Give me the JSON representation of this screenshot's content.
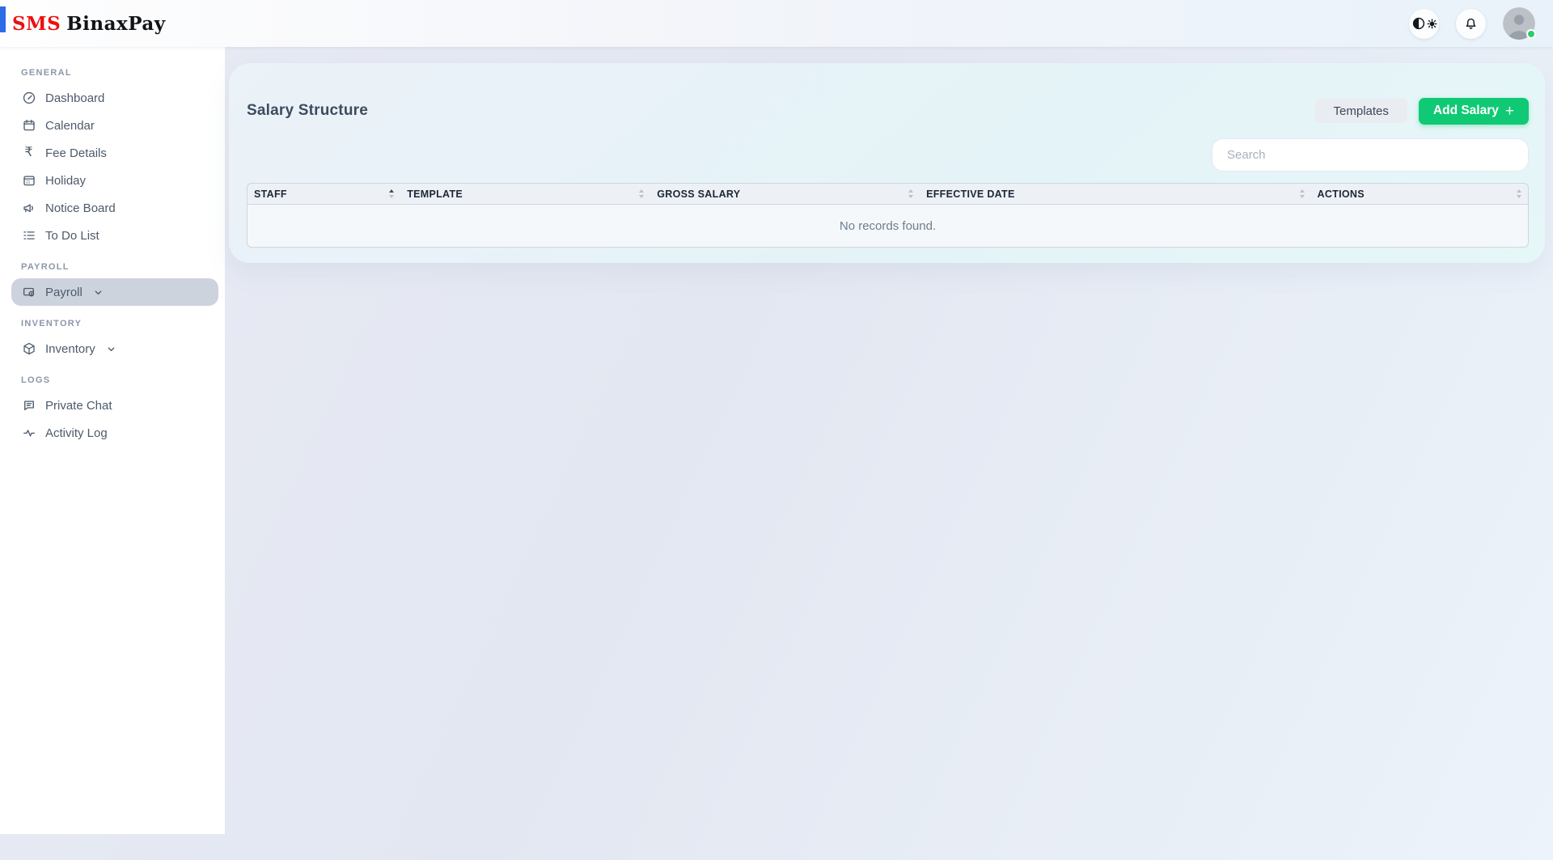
{
  "topbar": {
    "logo_sms": "SMS",
    "logo_brand": "BinaxPay",
    "icons": {
      "theme_toggle": "contrast-sun-icon",
      "notifications": "bell-icon",
      "avatar": "user-avatar",
      "status": "online-green-dot"
    }
  },
  "sidebar": {
    "sections": [
      {
        "label": "GENERAL",
        "items": [
          {
            "label": "Dashboard",
            "icon": "dashboard-gauge-icon"
          },
          {
            "label": "Calendar",
            "icon": "calendar-icon"
          },
          {
            "label": "Fee Details",
            "icon": "rupee-icon"
          },
          {
            "label": "Holiday",
            "icon": "holiday-calendar-icon"
          },
          {
            "label": "Notice Board",
            "icon": "megaphone-icon"
          },
          {
            "label": "To Do List",
            "icon": "todo-list-icon"
          }
        ]
      },
      {
        "label": "PAYROLL",
        "items": [
          {
            "label": "Payroll",
            "icon": "payroll-cheque-icon",
            "expandable": true,
            "active": true
          }
        ]
      },
      {
        "label": "INVENTORY",
        "items": [
          {
            "label": "Inventory",
            "icon": "package-box-icon",
            "expandable": true
          }
        ]
      },
      {
        "label": "LOGS",
        "items": [
          {
            "label": "Private Chat",
            "icon": "chat-bubble-icon"
          },
          {
            "label": "Activity Log",
            "icon": "activity-pulse-icon"
          }
        ]
      }
    ]
  },
  "main": {
    "title": "Salary Structure",
    "buttons": {
      "templates": "Templates",
      "add_salary": "Add Salary",
      "add_salary_plus": "+"
    },
    "search": {
      "placeholder": "Search",
      "value": ""
    },
    "table": {
      "columns": [
        {
          "label": "STAFF",
          "sort": "asc"
        },
        {
          "label": "TEMPLATE",
          "sort": "none"
        },
        {
          "label": "GROSS SALARY",
          "sort": "none"
        },
        {
          "label": "EFFECTIVE DATE",
          "sort": "none"
        },
        {
          "label": "ACTIONS",
          "sort": "none"
        }
      ],
      "rows": [],
      "empty_message": "No records found."
    }
  },
  "colors": {
    "accent_blue": "#2e6be6",
    "logo_red": "#ee0f0f",
    "primary_green": "#10c974",
    "active_item_bg": "#ccd3dd",
    "online_dot": "#2ecc71"
  }
}
